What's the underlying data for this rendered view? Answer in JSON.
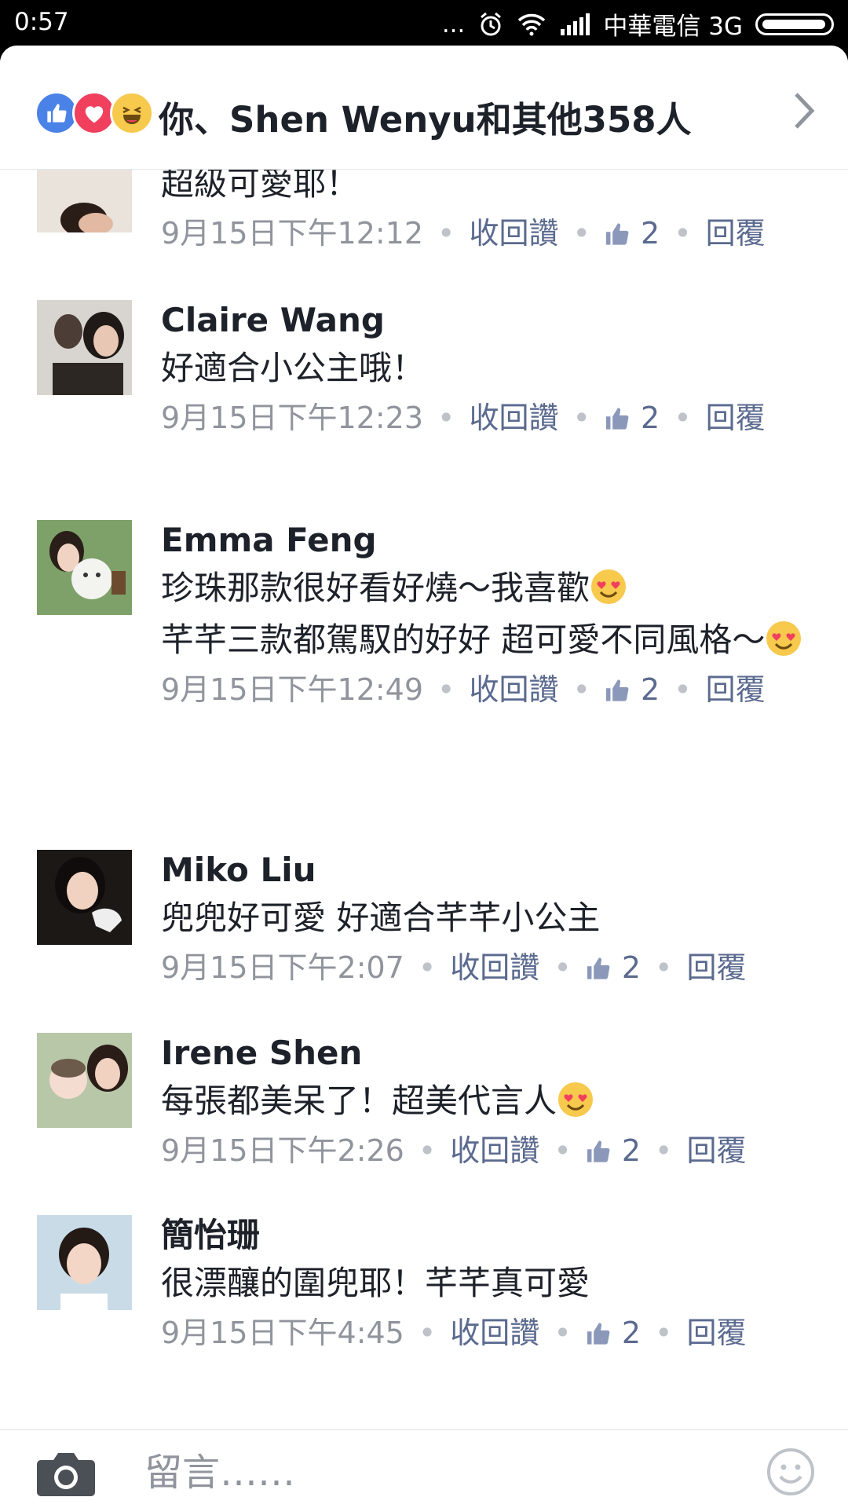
{
  "status_bar": {
    "time": "0:57",
    "carrier": "中華電信 3G",
    "dots": "..."
  },
  "reactions": {
    "summary": "你、Shen Wenyu和其他358人",
    "icons": [
      "like-icon",
      "love-icon",
      "haha-icon"
    ]
  },
  "comments": [
    {
      "name": "",
      "text": "超級可愛耶！",
      "time": "9月15日下午12:12",
      "unlike": "收回讚",
      "likes": "2",
      "reply": "回覆"
    },
    {
      "name": "Claire Wang",
      "text": "好適合小公主哦！",
      "time": "9月15日下午12:23",
      "unlike": "收回讚",
      "likes": "2",
      "reply": "回覆"
    },
    {
      "name": "Emma Feng",
      "text1": "珍珠那款很好看好燒～我喜歡",
      "text2": "芊芊三款都駕馭的好好 超可愛不同風格～",
      "time": "9月15日下午12:49",
      "unlike": "收回讚",
      "likes": "2",
      "reply": "回覆"
    },
    {
      "name": "Miko Liu",
      "text": "兜兜好可愛 好適合芊芊小公主",
      "time": "9月15日下午2:07",
      "unlike": "收回讚",
      "likes": "2",
      "reply": "回覆"
    },
    {
      "name": "Irene Shen",
      "text": "每張都美呆了！超美代言人",
      "time": "9月15日下午2:26",
      "unlike": "收回讚",
      "likes": "2",
      "reply": "回覆"
    },
    {
      "name": "簡怡珊",
      "text": "很漂釀的圍兜耶！芊芊真可愛",
      "time": "9月15日下午4:45",
      "unlike": "收回讚",
      "likes": "2",
      "reply": "回覆"
    }
  ],
  "composer": {
    "placeholder": "留言……"
  },
  "colors": {
    "link": "#5b6a8f",
    "meta": "#90949c",
    "name": "#1d2129",
    "like_blue": "#4a82e8"
  }
}
